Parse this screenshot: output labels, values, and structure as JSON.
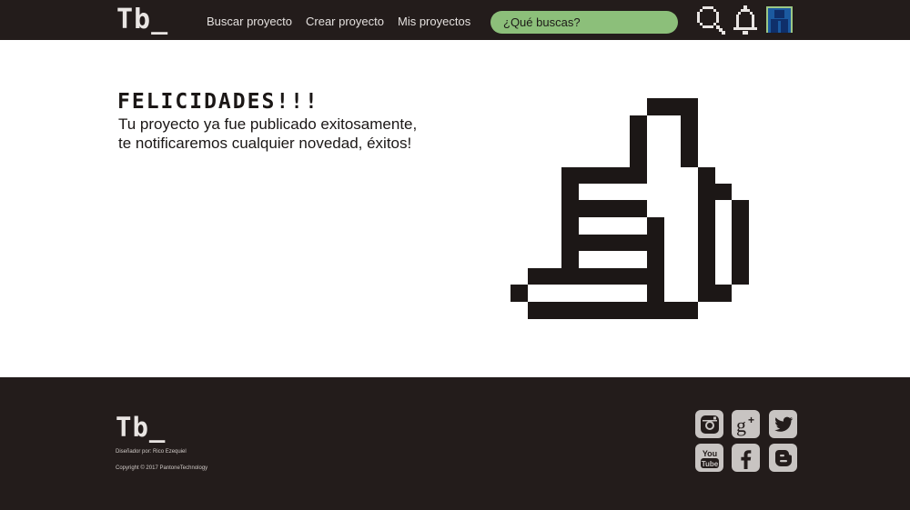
{
  "header": {
    "logo": "Tb_",
    "nav": [
      "Buscar proyecto",
      "Crear proyecto",
      "Mis proyectos"
    ],
    "search_placeholder": "¿Qué buscas?",
    "icons": [
      "search-icon",
      "bell-icon",
      "avatar"
    ]
  },
  "main": {
    "headline": "FELICIDADES!!!",
    "message_lines": [
      "Tu proyecto ya fue publicado exitosamente,",
      "te notificaremos cualquier novedad, éxitos!"
    ],
    "illustration": "thumbs-up-icon"
  },
  "footer": {
    "logo": "Tb_",
    "credit": "Diseñador por: Rico Ezequiel",
    "copyright": "Copyright © 2017 PantoneTechnology",
    "social": [
      "instagram-icon",
      "google-plus-icon",
      "twitter-icon",
      "youtube-icon",
      "facebook-icon",
      "blogger-icon"
    ]
  },
  "colors": {
    "dark": "#231c1b",
    "accent_green": "#8cbf7a",
    "social_gray": "#c8c4c2",
    "avatar_blue": "#1b5aa0"
  }
}
